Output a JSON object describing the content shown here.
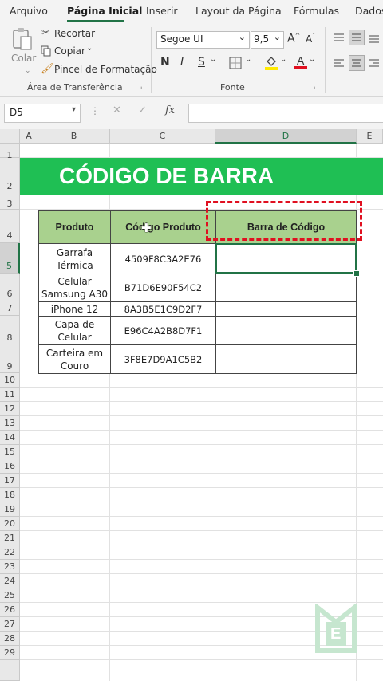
{
  "ribbon_tabs": [
    "Arquivo",
    "Página Inicial",
    "Inserir",
    "Layout da Página",
    "Fórmulas",
    "Dados"
  ],
  "active_tab": "Página Inicial",
  "clipboard": {
    "paste_label": "Colar",
    "cut_label": "Recortar",
    "copy_label": "Copiar",
    "format_painter_label": "Pincel de Formatação",
    "group_label": "Área de Transferência"
  },
  "font": {
    "name": "Segoe UI",
    "size": "9,5",
    "bold": "N",
    "italic": "I",
    "underline": "S",
    "group_label": "Fonte"
  },
  "formula_bar": {
    "name_box": "D5",
    "fx_label": "fx",
    "value": ""
  },
  "columns": [
    "A",
    "B",
    "C",
    "D",
    "E"
  ],
  "selected_column": "D",
  "rows": [
    "1",
    "2",
    "3",
    "4",
    "5",
    "6",
    "7",
    "8",
    "9",
    "10",
    "11",
    "12",
    "13",
    "14",
    "15",
    "16",
    "17",
    "18",
    "19",
    "20",
    "21",
    "22",
    "23",
    "24",
    "25",
    "26",
    "27",
    "28",
    "29"
  ],
  "selected_row": "5",
  "sheet": {
    "title": "CÓDIGO DE BARRA",
    "table": {
      "headers": [
        "Produto",
        "Código Produto",
        "Barra de Código"
      ],
      "rows": [
        {
          "produto": "Garrafa Térmica",
          "codigo": "4509F8C3A2E76",
          "barra": ""
        },
        {
          "produto": "Celular Samsung A30",
          "codigo": "B71D6E90F54C2",
          "barra": ""
        },
        {
          "produto": "iPhone 12",
          "codigo": "8A3B5E1C9D2F7",
          "barra": ""
        },
        {
          "produto": "Capa de Celular",
          "codigo": "E96C4A2B8D7F1",
          "barra": ""
        },
        {
          "produto": "Carteira em Couro",
          "codigo": "3F8E7D9A1C5B2",
          "barra": ""
        }
      ]
    }
  },
  "watermark_logo": "E",
  "colors": {
    "excel_green": "#217346",
    "title_band": "#1fbf54",
    "header_fill": "#a9d18e",
    "highlight_dash": "#e01020"
  }
}
